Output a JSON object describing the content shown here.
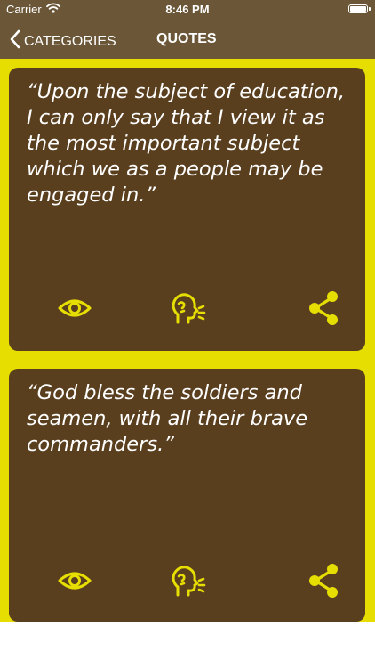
{
  "status_bar": {
    "carrier": "Carrier",
    "time": "8:46 PM",
    "icons": [
      "wifi-icon",
      "battery-icon"
    ]
  },
  "nav": {
    "back_label": "CATEGORIES",
    "title": "QUOTES",
    "back_icon": "chevron-left-icon"
  },
  "quotes": [
    {
      "text": "“Upon the subject of education, I can only say that I view it as the most important subject which we as a people may be engaged in.”",
      "actions": [
        "eye-icon",
        "speak-icon",
        "share-icon"
      ]
    },
    {
      "text": "“God bless the soldiers and seamen, with all their brave commanders.”",
      "actions": [
        "eye-icon",
        "speak-icon",
        "share-icon"
      ]
    }
  ],
  "colors": {
    "header": "#6b5738",
    "list_background": "#e6de00",
    "card": "#5a3f1f",
    "icon": "#e6de00",
    "text": "#ffffff"
  }
}
